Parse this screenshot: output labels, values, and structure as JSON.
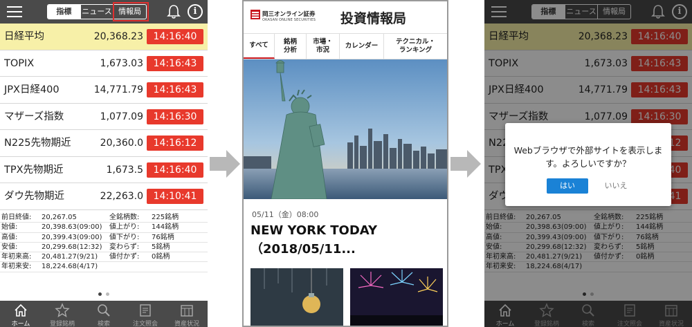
{
  "app": {
    "segments": [
      "指標",
      "ニュース",
      "情報局"
    ],
    "active_segment": "指標",
    "info_label": "i",
    "rows": [
      {
        "name": "日経平均",
        "value": "20,368.23",
        "time": "14:16:40"
      },
      {
        "name": "TOPIX",
        "value": "1,673.03",
        "time": "14:16:43"
      },
      {
        "name": "JPX日経400",
        "value": "14,771.79",
        "time": "14:16:43"
      },
      {
        "name": "マザーズ指数",
        "value": "1,077.09",
        "time": "14:16:30"
      },
      {
        "name": "N225先物期近",
        "value": "20,360.0",
        "time": "14:16:12"
      },
      {
        "name": "TPX先物期近",
        "value": "1,673.5",
        "time": "14:16:40"
      },
      {
        "name": "ダウ先物期近",
        "value": "22,263.0",
        "time": "14:10:41"
      }
    ],
    "stats": [
      {
        "l1": "前日終値:",
        "v1": "20,267.05",
        "l2": "全銘柄数:",
        "v2": "225銘柄"
      },
      {
        "l1": "始値:",
        "v1": "20,398.63(09:00)",
        "l2": "値上がり:",
        "v2": "144銘柄"
      },
      {
        "l1": "高値:",
        "v1": "20,399.43(09:00)",
        "l2": "値下がり:",
        "v2": "76銘柄"
      },
      {
        "l1": "安値:",
        "v1": "20,299.68(12:32)",
        "l2": "変わらず:",
        "v2": "5銘柄"
      },
      {
        "l1": "年初来高:",
        "v1": "20,481.27(9/21)",
        "l2": "値付かず:",
        "v2": "0銘柄"
      },
      {
        "l1": "年初来安:",
        "v1": "18,224.68(4/17)",
        "l2": "",
        "v2": ""
      }
    ],
    "tabs": [
      "ホーム",
      "登録銘柄",
      "検索",
      "注文照会",
      "資産状況"
    ],
    "active_tab": "ホーム",
    "colors": {
      "bar": "#4a4a4a",
      "time_badge": "#e8392c",
      "highlight_row": "#f7f0a8",
      "annotation": "#e03030"
    }
  },
  "dialog": {
    "message": "Webブラウザで外部サイトを表示します。よろしいですか？",
    "yes_label": "はい",
    "no_label": "いいえ",
    "yes_color": "#1a82d6"
  },
  "web": {
    "logo_text": "岡三オンライン証券",
    "logo_sub": "OKASAN ONLINE SECURITIES",
    "title": "投資情報局",
    "tabs": [
      "すべて",
      "銘柄\n分析",
      "市場・\n市況",
      "カレンダー",
      "テクニカル・\nランキング"
    ],
    "active_tab": "すべて",
    "article_date": "05/11（金）08:00",
    "article_title": "NEW YORK TODAY（2018/05/11...",
    "brand_color": "#c8161d"
  }
}
